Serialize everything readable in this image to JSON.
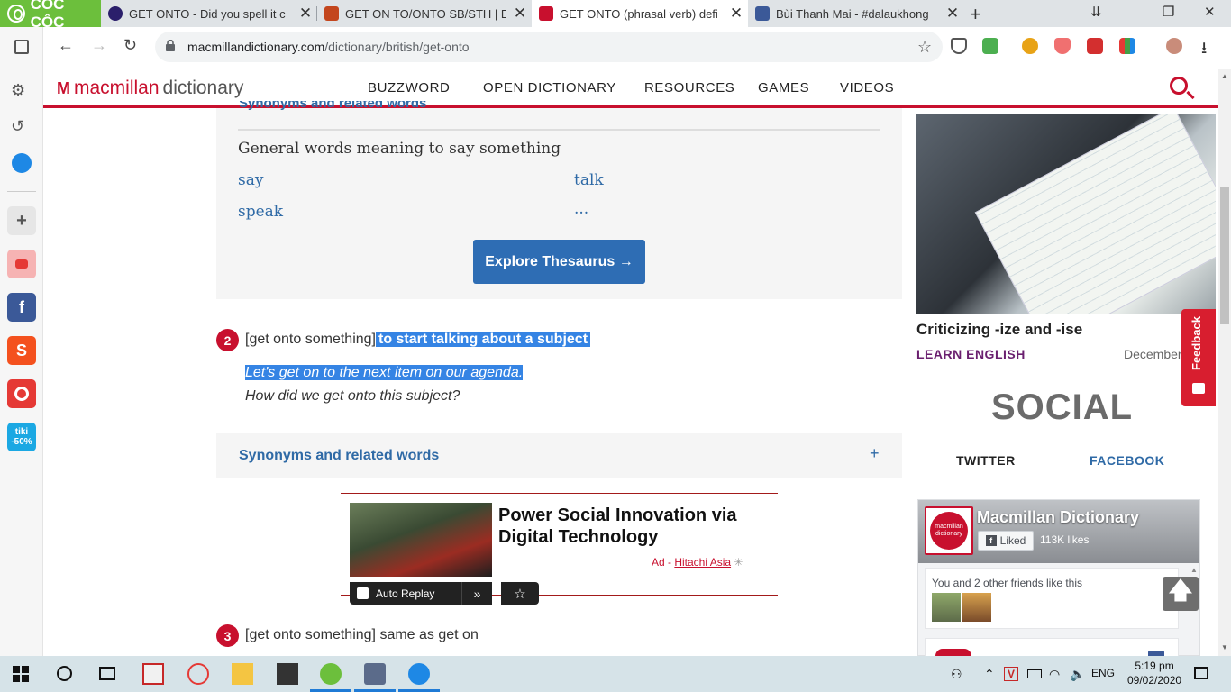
{
  "browser": {
    "brand": "CỐC CỐC",
    "tabs": [
      {
        "title": "GET ONTO - Did you spell it c",
        "favicon_color": "#2b1f6b"
      },
      {
        "title": "GET ON TO/ONTO SB/STH | E",
        "favicon_color": "#c3461d"
      },
      {
        "title": "GET ONTO (phrasal verb) defi",
        "favicon_color": "#c8102e",
        "active": true
      },
      {
        "title": "Bùi Thanh Mai - #dalaukhong",
        "favicon_color": "#3b5998"
      }
    ],
    "new_tab": "+",
    "close_glyph": "✕",
    "window_controls": {
      "minimize": "⇊",
      "restore": "❐",
      "close": "✕"
    },
    "url_domain": "macmillandictionary.com",
    "url_path": "/dictionary/british/get-onto"
  },
  "sidebar": {
    "items": [
      "settings-icon",
      "history-icon",
      "messenger-icon",
      "add-icon",
      "youtube-icon",
      "facebook-icon",
      "shopee-icon",
      "app-icon",
      "tiki-icon"
    ],
    "tiki_label_1": "tiki",
    "tiki_label_2": "-50%",
    "facebook_glyph": "f",
    "shopee_glyph": "S"
  },
  "site": {
    "logo_mark": "M",
    "logo_brand": "macmillan",
    "logo_suffix": "dictionary",
    "nav": [
      "BUZZWORD",
      "OPEN DICTIONARY",
      "RESOURCES",
      "GAMES",
      "VIDEOS"
    ]
  },
  "thesaurus": {
    "cut_heading": "Synonyms and related words",
    "heading": "General words meaning to say something",
    "words": [
      "say",
      "talk",
      "speak",
      "..."
    ],
    "button": "Explore Thesaurus →"
  },
  "senses": [
    {
      "number": "2",
      "pattern": "[get onto something]",
      "definition": "to start talking about a subject",
      "examples": [
        "Let's get on to the next item on our agenda.",
        "How did we get onto this subject?"
      ]
    },
    {
      "number": "3",
      "pattern": "[get onto something]",
      "definition": "same as get on"
    }
  ],
  "synonyms_bar": {
    "label": "Synonyms and related words",
    "toggle": "+"
  },
  "ad": {
    "title": "Power Social Innovation via Digital Technology",
    "prefix": "Ad - ",
    "source": "Hitachi Asia",
    "auto_replay": "Auto Replay",
    "next_glyph": "»",
    "star_glyph": "☆"
  },
  "right": {
    "article_title": "Criticizing -ize and -ise",
    "tag": "LEARN ENGLISH",
    "date": "December",
    "feedback": "Feedback",
    "social_heading": "SOCIAL",
    "social_tabs": [
      "TWITTER",
      "FACEBOOK"
    ],
    "fb": {
      "page_name": "Macmillan Dictionary",
      "avatar_text": "macmillan dictionary",
      "liked": "Liked",
      "liked_glyph": "f",
      "likes": "113K likes",
      "friends": "You and 2 other friends like this"
    },
    "to_top_glyph": "🡅"
  },
  "taskbar": {
    "tray_lang": "ENG",
    "time": "5:19 pm",
    "date": "09/02/2020"
  },
  "colors": {
    "brand_red": "#c8102e",
    "link_blue": "#2f6aa6",
    "button_blue": "#2e6db4",
    "selection": "#3584e4",
    "coccoc_green": "#6cbf3c"
  }
}
